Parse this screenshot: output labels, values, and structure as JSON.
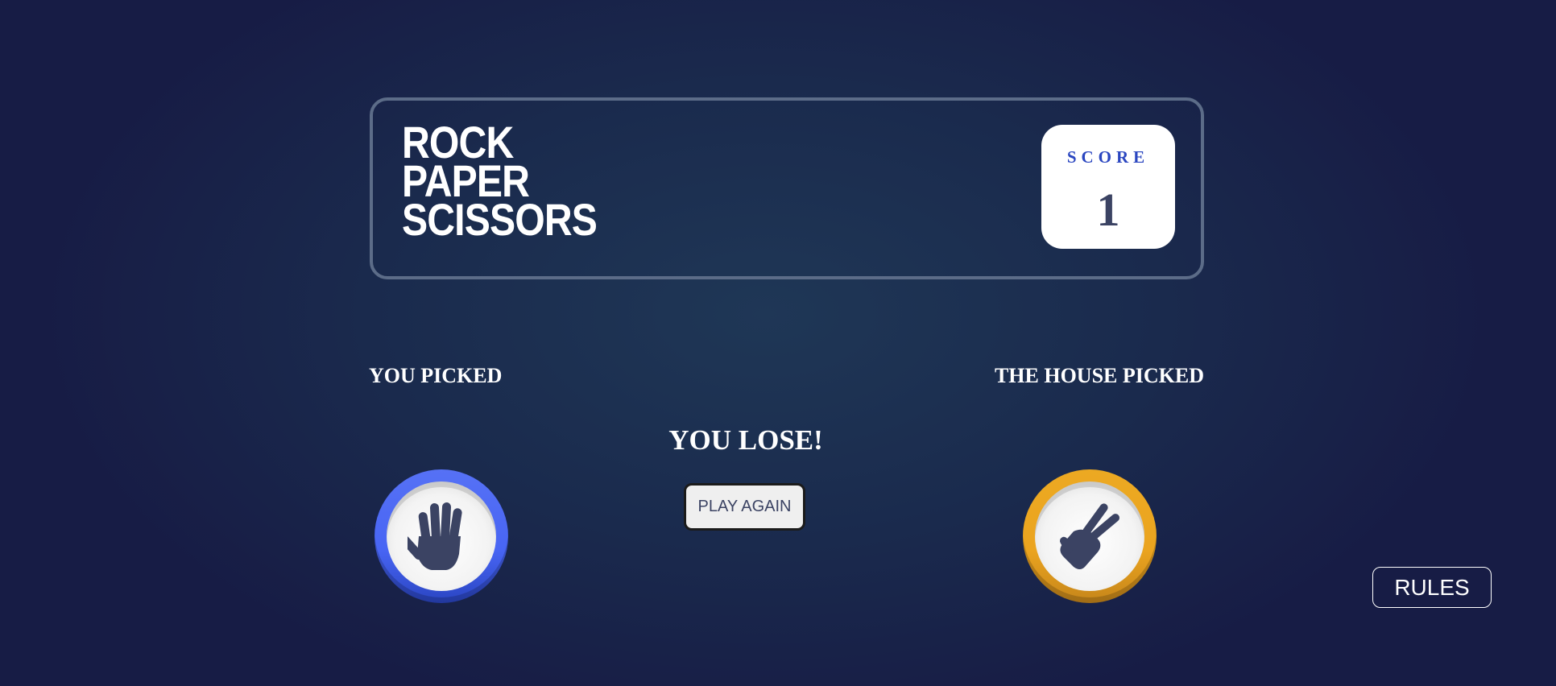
{
  "header": {
    "title_lines": [
      "ROCK",
      "PAPER",
      "SCISSORS"
    ],
    "score_label": "SCORE",
    "score_value": "1"
  },
  "game": {
    "player_label": "YOU PICKED",
    "house_label": "THE HOUSE PICKED",
    "player_choice_icon": "paper-hand-icon",
    "house_choice_icon": "scissors-hand-icon",
    "result_text": "YOU LOSE!",
    "play_again_label": "PLAY AGAIN"
  },
  "footer": {
    "rules_label": "RULES"
  },
  "colors": {
    "background": "#1f3756",
    "paper_ring": "#4865f4",
    "scissors_ring": "#eca922",
    "score_label": "#2a46c0",
    "dark_text": "#3b4363"
  }
}
